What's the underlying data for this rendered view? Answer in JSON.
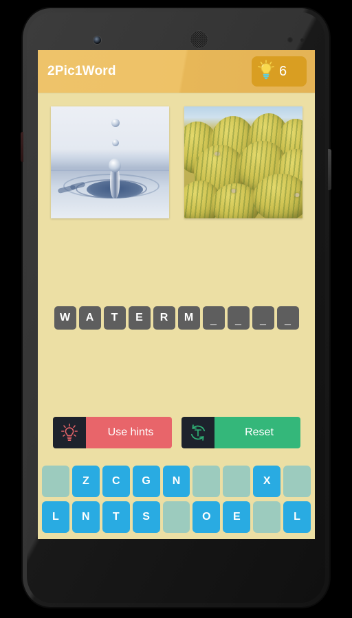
{
  "app": {
    "header": {
      "title": "2Pic1Word",
      "hint_icon": "lightbulb-icon",
      "hint_count": "6",
      "header_color": "#eec267",
      "badge_color": "#d99e22"
    },
    "pictures": [
      {
        "name": "water-drop-photo",
        "description": "Water droplet splashing into a still pool with ripples"
      },
      {
        "name": "melons-photo",
        "description": "Pile of yellow-green striped melons under a blue sky"
      }
    ],
    "answer": {
      "word_in_progress": "WATERM____",
      "slots": [
        {
          "letter": "W",
          "filled": true
        },
        {
          "letter": "A",
          "filled": true
        },
        {
          "letter": "T",
          "filled": true
        },
        {
          "letter": "E",
          "filled": true
        },
        {
          "letter": "R",
          "filled": true
        },
        {
          "letter": "M",
          "filled": true
        },
        {
          "letter": "_",
          "filled": false
        },
        {
          "letter": "_",
          "filled": false
        },
        {
          "letter": "_",
          "filled": false
        },
        {
          "letter": "_",
          "filled": false
        }
      ]
    },
    "actions": {
      "hints": {
        "label": "Use hints",
        "icon": "lightbulb-icon",
        "color": "#e8656a"
      },
      "reset": {
        "label": "Reset",
        "icon": "reset-circle-icon",
        "color": "#34b77a"
      }
    },
    "keyboard": {
      "key_color": "#29ABE2",
      "empty_key_color": "#9ccbbe",
      "rows": [
        [
          {
            "letter": "",
            "used": true
          },
          {
            "letter": "Z",
            "used": false
          },
          {
            "letter": "C",
            "used": false
          },
          {
            "letter": "G",
            "used": false
          },
          {
            "letter": "N",
            "used": false
          },
          {
            "letter": "",
            "used": true
          },
          {
            "letter": "",
            "used": true
          },
          {
            "letter": "X",
            "used": false
          },
          {
            "letter": "",
            "used": true
          }
        ],
        [
          {
            "letter": "L",
            "used": false
          },
          {
            "letter": "N",
            "used": false
          },
          {
            "letter": "T",
            "used": false
          },
          {
            "letter": "S",
            "used": false
          },
          {
            "letter": "",
            "used": true
          },
          {
            "letter": "O",
            "used": false
          },
          {
            "letter": "E",
            "used": false
          },
          {
            "letter": "",
            "used": true
          },
          {
            "letter": "L",
            "used": false
          }
        ]
      ]
    }
  },
  "device": {
    "name": "android-phone-frame",
    "camera": "front-camera",
    "speaker": "earpiece-speaker"
  }
}
